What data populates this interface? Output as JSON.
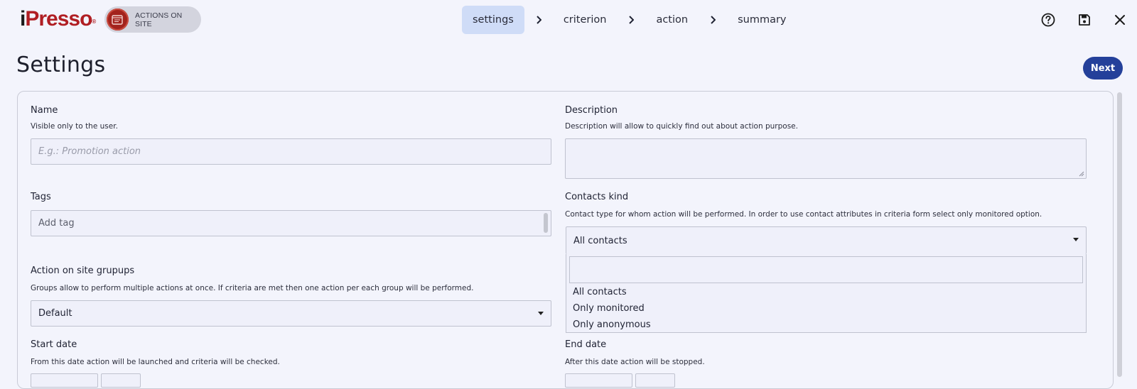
{
  "header": {
    "logo_text": "iPresso",
    "module_label": "ACTIONS ON SITE",
    "steps": [
      {
        "label": "settings",
        "active": true
      },
      {
        "label": "criterion",
        "active": false
      },
      {
        "label": "action",
        "active": false
      },
      {
        "label": "summary",
        "active": false
      }
    ],
    "icons": [
      "help-icon",
      "save-icon",
      "close-icon"
    ]
  },
  "page": {
    "title": "Settings",
    "next_label": "Next"
  },
  "form": {
    "name": {
      "label": "Name",
      "help": "Visible only to the user.",
      "placeholder": "E.g.: Promotion action"
    },
    "description": {
      "label": "Description",
      "help": "Description will allow to quickly find out about action purpose.",
      "value": ""
    },
    "tags": {
      "label": "Tags",
      "placeholder": "Add tag"
    },
    "contacts_kind": {
      "label": "Contacts kind",
      "help": "Contact type for whom action will be performed. In order to use contact attributes in criteria form select only monitored option.",
      "selected": "All contacts",
      "search_value": "",
      "options": [
        "All contacts",
        "Only monitored",
        "Only anonymous"
      ]
    },
    "groups": {
      "label": "Action on site grupups",
      "help": "Groups allow to perform multiple actions at once. If criteria are met then one action per each group will be performed.",
      "selected": "Default"
    },
    "start_date": {
      "label": "Start date",
      "help": "From this date action will be launched and criteria will be checked."
    },
    "end_date": {
      "label": "End date",
      "help": "After this date action will be stopped."
    }
  },
  "colors": {
    "brand_red": "#b01e23",
    "primary_blue": "#24409a",
    "active_step_bg": "#cfdcf7",
    "page_bg": "#f3f4fc"
  }
}
